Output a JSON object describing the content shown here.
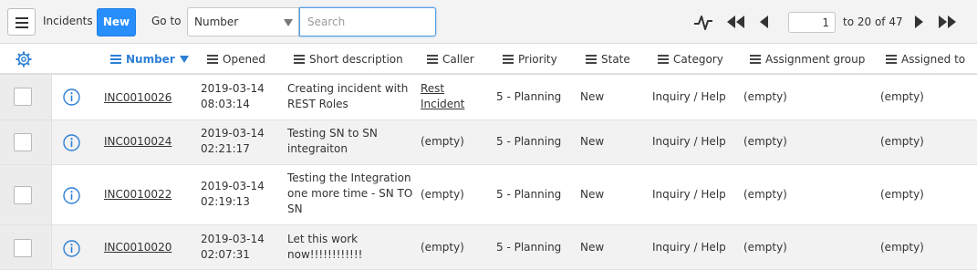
{
  "toolbar": {
    "title": "Incidents",
    "new_label": "New",
    "goto_label": "Go to",
    "field_select": "Number",
    "search_placeholder": "Search",
    "page_value": "1",
    "page_range": "to 20 of 47"
  },
  "columns": {
    "number": "Number",
    "opened": "Opened",
    "short_description": "Short description",
    "caller": "Caller",
    "priority": "Priority",
    "state": "State",
    "category": "Category",
    "assignment_group": "Assignment group",
    "assigned_to": "Assigned to"
  },
  "rows": [
    {
      "number": "INC0010026",
      "opened_date": "2019-03-14",
      "opened_time": "08:03:14",
      "desc_lines": [
        "Creating incident with",
        "REST Roles"
      ],
      "caller_lines": [
        "Rest",
        "Incident"
      ],
      "priority": "5 - Planning",
      "state": "New",
      "category": "Inquiry / Help",
      "assignment_group": "(empty)",
      "assigned_to": "(empty)"
    },
    {
      "number": "INC0010024",
      "opened_date": "2019-03-14",
      "opened_time": "02:21:17",
      "desc_lines": [
        "Testing SN to SN",
        "integraiton"
      ],
      "caller": "(empty)",
      "priority": "5 - Planning",
      "state": "New",
      "category": "Inquiry / Help",
      "assignment_group": "(empty)",
      "assigned_to": "(empty)"
    },
    {
      "number": "INC0010022",
      "opened_date": "2019-03-14",
      "opened_time": "02:19:13",
      "desc_lines": [
        "Testing the Integration",
        "one more time - SN TO",
        "SN"
      ],
      "caller": "(empty)",
      "priority": "5 - Planning",
      "state": "New",
      "category": "Inquiry / Help",
      "assignment_group": "(empty)",
      "assigned_to": "(empty)"
    },
    {
      "number": "INC0010020",
      "opened_date": "2019-03-14",
      "opened_time": "02:07:31",
      "desc_lines": [
        "Let this work",
        "now!!!!!!!!!!!!"
      ],
      "caller": "(empty)",
      "priority": "5 - Planning",
      "state": "New",
      "category": "Inquiry / Help",
      "assignment_group": "(empty)",
      "assigned_to": "(empty)"
    }
  ],
  "icons": {
    "menu": "hamburger-menu-icon",
    "activity": "activity-pulse-icon",
    "first": "first-page-icon",
    "prev": "previous-page-icon",
    "next": "next-page-icon",
    "last": "last-page-icon",
    "settings": "gear-icon",
    "preview": "info-circle-icon"
  },
  "colors": {
    "accent": "#278efc",
    "active_header": "#2d7fd6",
    "toolbar_bg": "#f3f3f3",
    "row_alt": "#f2f2f2"
  }
}
